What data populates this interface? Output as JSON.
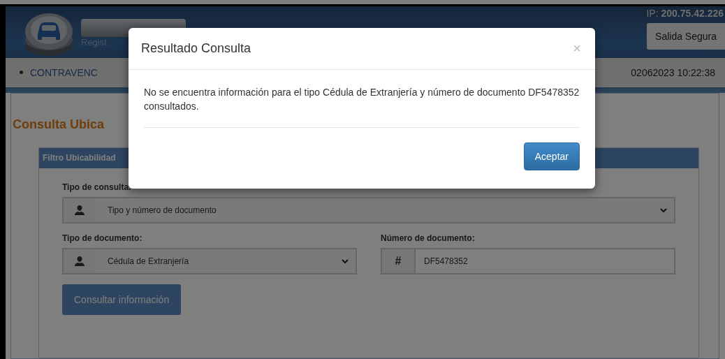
{
  "header": {
    "logo_subtitle": "Regist",
    "ip": "IP: **200.75.42.226**",
    "logout_button": "Salida Segura"
  },
  "nav": {
    "items": [
      {
        "label": "CONTRAVENC"
      }
    ],
    "datetime": "02062023 10:22:38"
  },
  "page_title": "Consulta Ubica",
  "filter_panel": {
    "title": "Filtro Ubicabilidad",
    "rows": [
      [
        {
          "kind": "select",
          "label": "Tipo de consulta:",
          "value": "Tipo y número de documento"
        }
      ],
      [
        {
          "kind": "select",
          "label": "Tipo de documento:",
          "value": "Cédula de Extranjería"
        },
        {
          "kind": "input",
          "label": "Número de documento:",
          "prefix": "#",
          "value": "DF5478352"
        }
      ]
    ],
    "submit_button": "Consultar información"
  },
  "modal": {
    "title": "Resultado Consulta",
    "close": "×",
    "message": "No se encuentra información para el tipo Cédula de Extranjería y número de documento DF5478352 consultados.",
    "button": "Aceptar"
  }
}
